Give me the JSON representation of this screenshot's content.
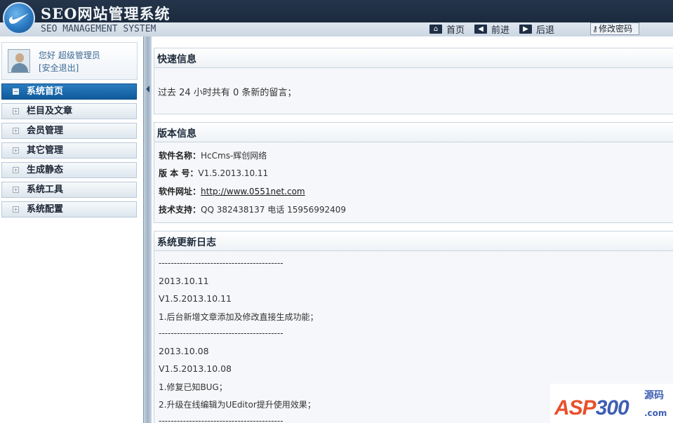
{
  "header": {
    "title_cn": "SEO网站管理系统",
    "title_en": "SEO MANAGEMENT SYSTEM",
    "nav": [
      {
        "label": "首页",
        "icon": "home-icon"
      },
      {
        "label": "前进",
        "icon": "arrow-left-icon"
      },
      {
        "label": "后退",
        "icon": "arrow-right-icon"
      }
    ],
    "change_password": "修改密码"
  },
  "sidebar": {
    "greeting": "您好 超级管理员",
    "logout": "[安全退出]",
    "menu": [
      {
        "label": "系统首页",
        "active": true
      },
      {
        "label": "栏目及文章",
        "active": false
      },
      {
        "label": "会员管理",
        "active": false
      },
      {
        "label": "其它管理",
        "active": false
      },
      {
        "label": "生成静态",
        "active": false
      },
      {
        "label": "系统工具",
        "active": false
      },
      {
        "label": "系统配置",
        "active": false
      }
    ]
  },
  "quick": {
    "title": "快速信息",
    "text": "过去 24 小时共有 0 条新的留言；"
  },
  "version": {
    "title": "版本信息",
    "rows": [
      {
        "label": "软件名称：",
        "value": "HcCms-辉创网络"
      },
      {
        "label": "版 本 号：",
        "value": "V1.5.2013.10.11"
      },
      {
        "label": "软件网址：",
        "value": "http://www.0551net.com"
      },
      {
        "label": "技术支持：",
        "value": "QQ 382438137 电话 15956992409"
      }
    ]
  },
  "updates": {
    "title": "系统更新日志",
    "lines": [
      "-----------------------------------------",
      "2013.10.11",
      "V1.5.2013.10.11",
      "1.后台新增文章添加及修改直接生成功能；",
      "-----------------------------------------",
      "2013.10.08",
      "V1.5.2013.10.08",
      "1.修复已知BUG；",
      "2.升级在线编辑为UEditor提升使用效果；",
      "-----------------------------------------"
    ]
  },
  "watermark": {
    "asp": "ASP",
    "num": "300",
    "tag": "源码",
    "domain": ".com"
  }
}
